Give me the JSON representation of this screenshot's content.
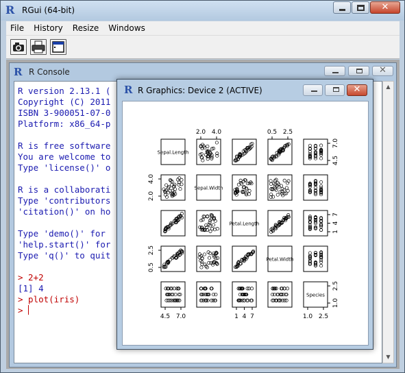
{
  "app": {
    "title": "RGui (64-bit)",
    "icon": "r-logo-icon",
    "menu": [
      "File",
      "History",
      "Resize",
      "Windows"
    ],
    "toolbar": [
      "open-script-icon",
      "print-icon",
      "console-icon"
    ]
  },
  "console": {
    "title": "R Console",
    "lines": [
      {
        "text": "R version 2.13.1 (",
        "kind": "output"
      },
      {
        "text": "Copyright (C) 2011",
        "kind": "output"
      },
      {
        "text": "ISBN 3-900051-07-0",
        "kind": "output"
      },
      {
        "text": "Platform: x86_64-p",
        "kind": "output"
      },
      {
        "text": "",
        "kind": "blank"
      },
      {
        "text": "R is free software",
        "kind": "output"
      },
      {
        "text": "You are welcome to",
        "kind": "output"
      },
      {
        "text": "Type 'license()' o",
        "kind": "output"
      },
      {
        "text": "",
        "kind": "blank"
      },
      {
        "text": "R is a collaborati",
        "kind": "output"
      },
      {
        "text": "Type 'contributors",
        "kind": "output"
      },
      {
        "text": "'citation()' on ho",
        "kind": "output"
      },
      {
        "text": "",
        "kind": "blank"
      },
      {
        "text": "Type 'demo()' for",
        "kind": "output"
      },
      {
        "text": "'help.start()' for",
        "kind": "output"
      },
      {
        "text": "Type 'q()' to quit",
        "kind": "output"
      },
      {
        "text": "",
        "kind": "blank"
      },
      {
        "text": "> 2+2",
        "kind": "input"
      },
      {
        "text": "[1] 4",
        "kind": "output"
      },
      {
        "text": "> plot(iris)",
        "kind": "input"
      },
      {
        "text": "> ",
        "kind": "prompt"
      }
    ]
  },
  "graphics": {
    "title": "R Graphics: Device 2 (ACTIVE)",
    "pairs_plot": {
      "variables": [
        "Sepal.Length",
        "Sepal.Width",
        "Petal.Length",
        "Petal.Width",
        "Species"
      ],
      "top_ticks": [
        {
          "col": 1,
          "labels": [
            "2.0",
            "4.0"
          ]
        },
        {
          "col": 3,
          "labels": [
            "0.5",
            "2.5"
          ]
        }
      ],
      "bottom_ticks": [
        {
          "col": 0,
          "labels": [
            "4.5",
            "7.0"
          ]
        },
        {
          "col": 2,
          "labels": [
            "1",
            "4",
            "7"
          ]
        },
        {
          "col": 4,
          "labels": [
            "1.0",
            "2.5"
          ]
        }
      ],
      "left_ticks": [
        {
          "row": 1,
          "labels": [
            "2.0",
            "4.0"
          ]
        },
        {
          "row": 3,
          "labels": [
            "0.5",
            "2.5"
          ]
        }
      ],
      "right_ticks": [
        {
          "row": 0,
          "labels": [
            "4.5",
            "7.0"
          ]
        },
        {
          "row": 2,
          "labels": [
            "1",
            "4",
            "7"
          ]
        },
        {
          "row": 4,
          "labels": [
            "1.0",
            "2.5"
          ]
        }
      ]
    }
  }
}
